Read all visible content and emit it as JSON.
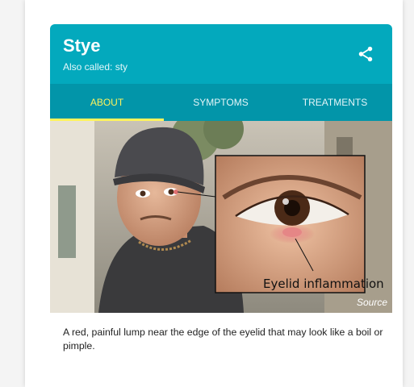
{
  "card": {
    "title": "Stye",
    "subtitle": "Also called: sty",
    "share_icon": "share-icon"
  },
  "tabs": [
    {
      "label": "ABOUT",
      "active": true
    },
    {
      "label": "SYMPTOMS",
      "active": false
    },
    {
      "label": "TREATMENTS",
      "active": false
    }
  ],
  "image": {
    "callout": "Eyelid inflammation",
    "source_label": "Source"
  },
  "description": "A red, painful lump near the edge of the eyelid that may look like a boil or pimple.",
  "colors": {
    "header": "#03a9bd",
    "tab_bar": "#0295a9",
    "active_tab": "#fff35c"
  }
}
